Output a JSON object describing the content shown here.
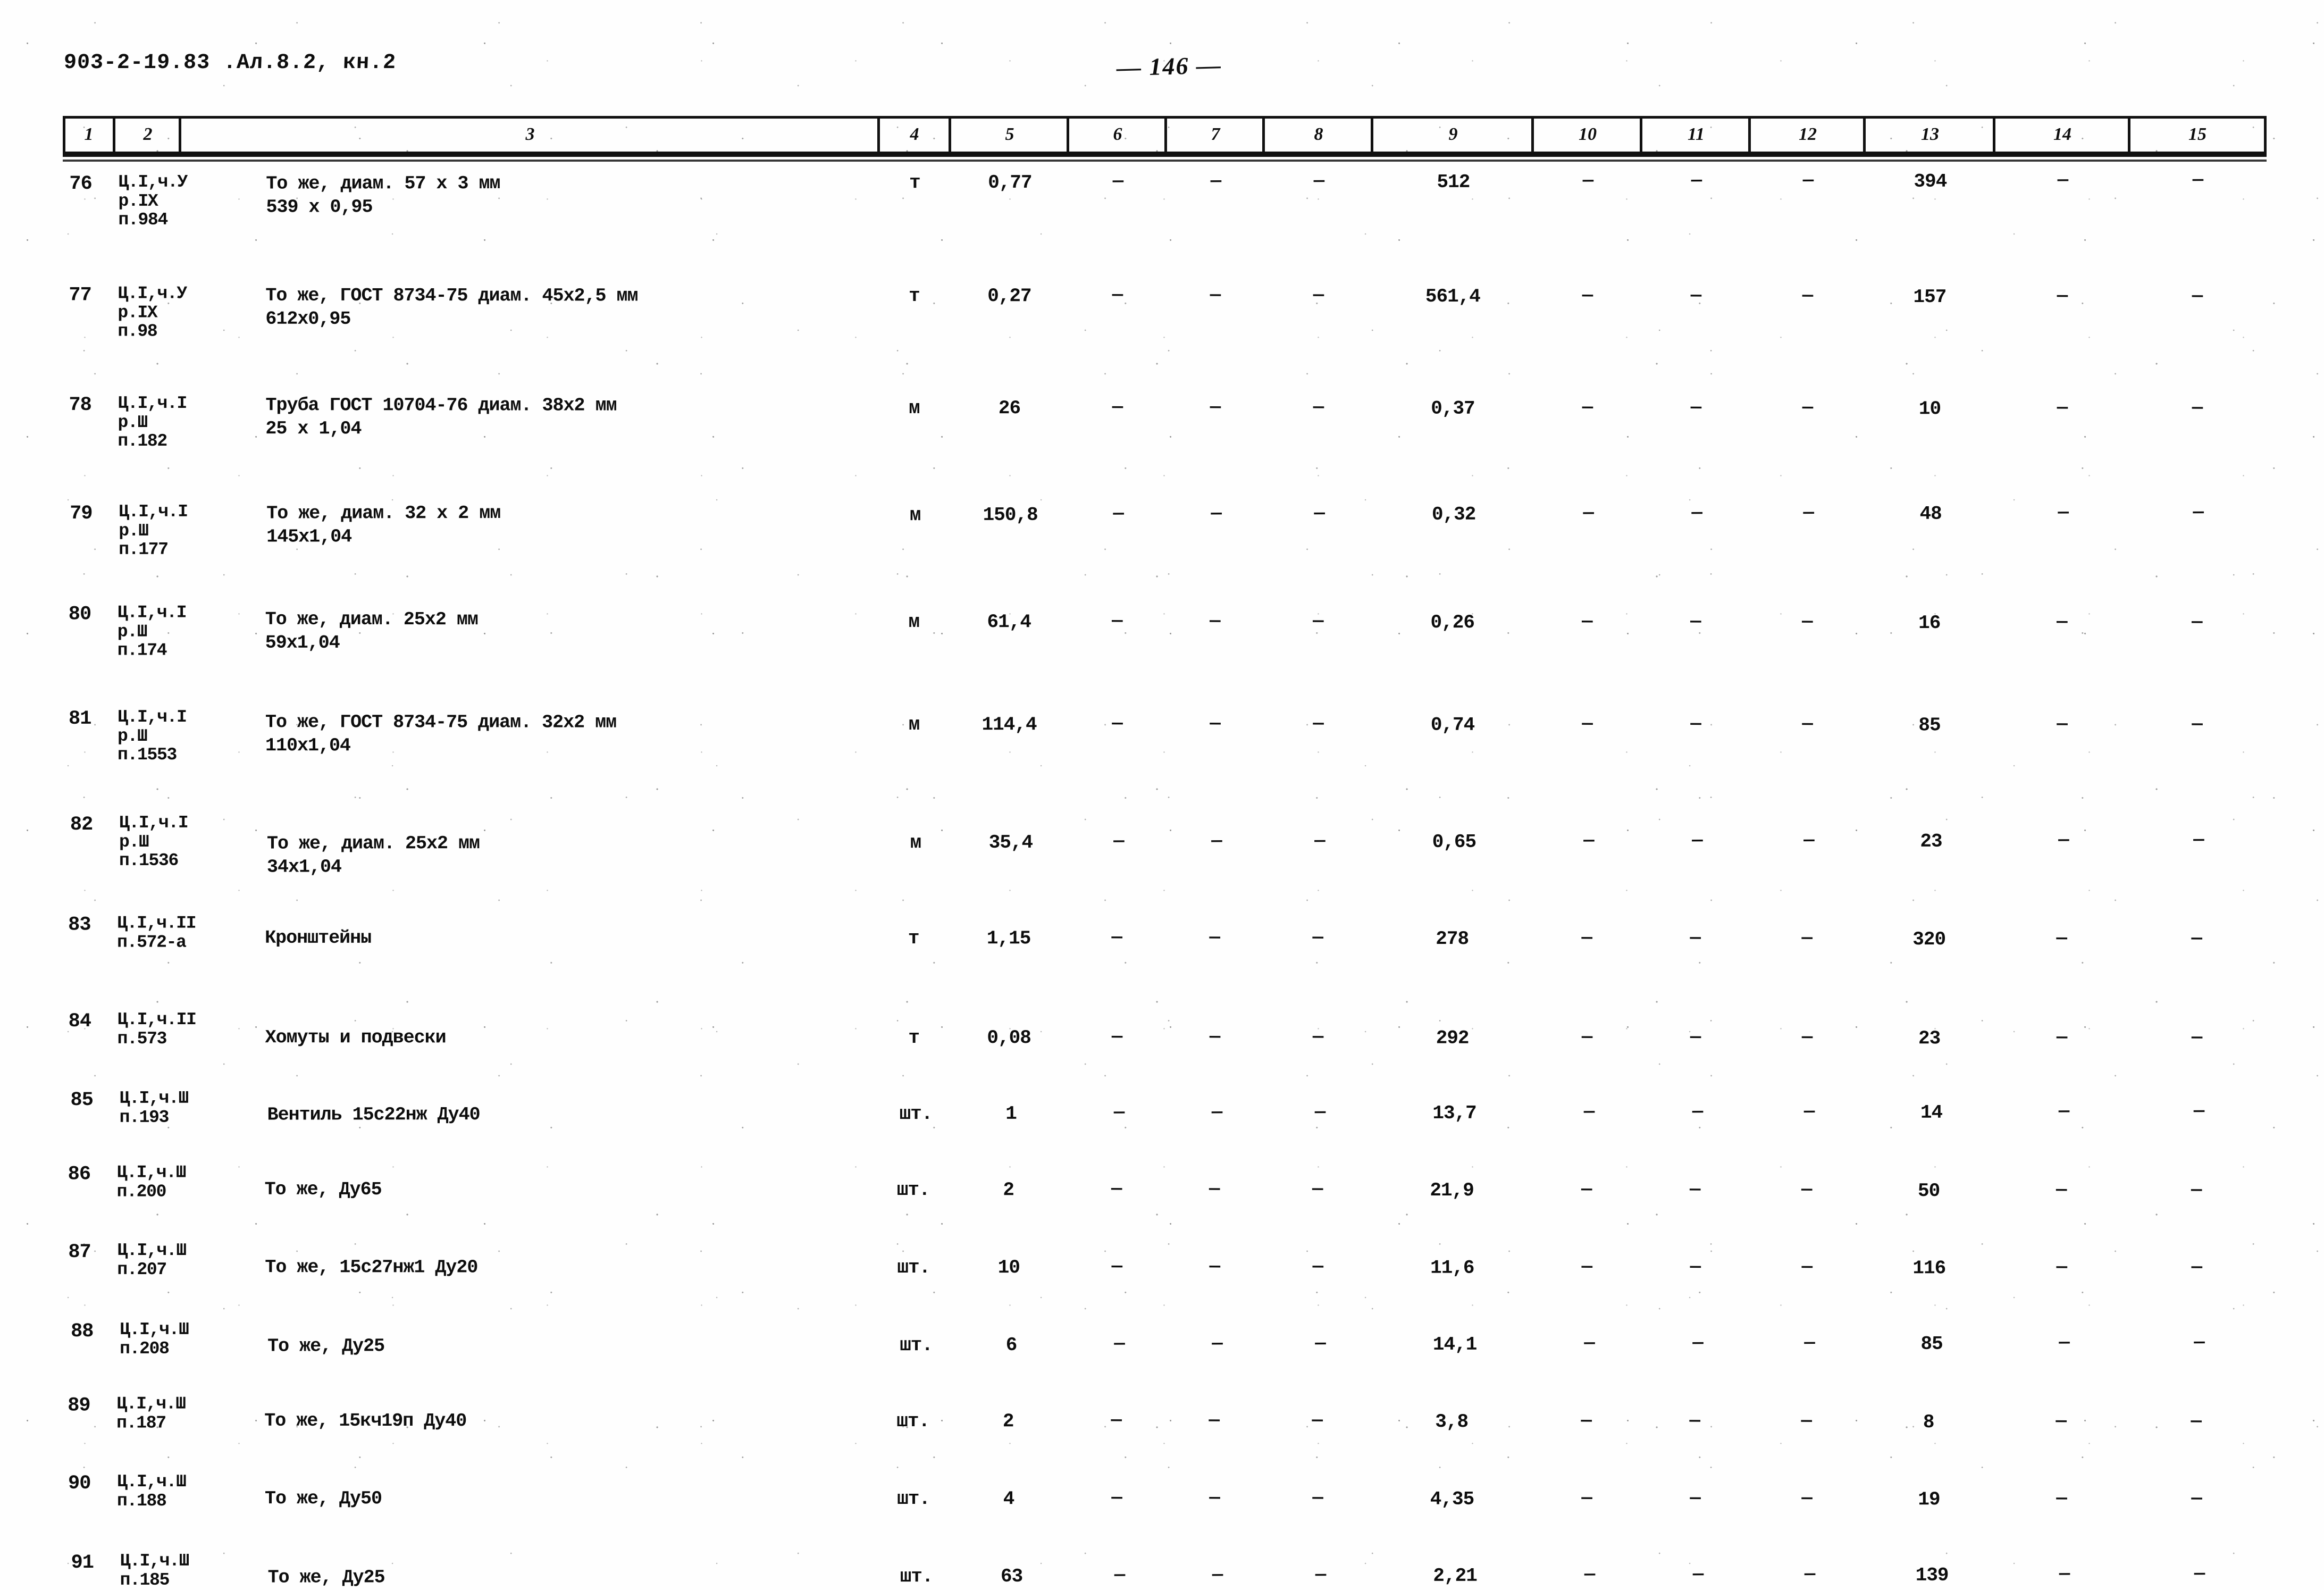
{
  "header": {
    "doc_code": "903-2-19.83 .Ал.8.2, кн.2",
    "page_label": "— 146 —"
  },
  "table": {
    "column_headers": [
      "1",
      "2",
      "3",
      "4",
      "5",
      "6",
      "7",
      "8",
      "9",
      "10",
      "11",
      "12",
      "13",
      "14",
      "15"
    ],
    "dash": "—",
    "rows": [
      {
        "n": "76",
        "ref": [
          "Ц.I,ч.У",
          "р.IX",
          "п.984"
        ],
        "desc": [
          "То же, диам. 57 х 3 мм",
          "539 х 0,95"
        ],
        "c4": "т",
        "c5": "0,77",
        "c6": "—",
        "c7": "—",
        "c8": "—",
        "c9": "512",
        "c10": "—",
        "c11": "—",
        "c12": "—",
        "c13": "394",
        "c14": "—",
        "c15": "—"
      },
      {
        "n": "77",
        "ref": [
          "Ц.I,ч.У",
          "р.IX",
          "п.98"
        ],
        "desc": [
          "То же, ГОСТ 8734-75 диам. 45х2,5 мм",
          "612х0,95"
        ],
        "c4": "т",
        "c5": "0,27",
        "c6": "—",
        "c7": "—",
        "c8": "—",
        "c9": "561,4",
        "c10": "—",
        "c11": "—",
        "c12": "—",
        "c13": "157",
        "c14": "—",
        "c15": "—"
      },
      {
        "n": "78",
        "ref": [
          "Ц.I,ч.I",
          "р.Ш",
          "п.182"
        ],
        "desc": [
          "Труба ГОСТ 10704-76 диам. 38х2 мм",
          "25 х 1,04"
        ],
        "c4": "м",
        "c5": "26",
        "c6": "—",
        "c7": "—",
        "c8": "—",
        "c9": "0,37",
        "c10": "—",
        "c11": "—",
        "c12": "—",
        "c13": "10",
        "c14": "—",
        "c15": "—"
      },
      {
        "n": "79",
        "ref": [
          "Ц.I,ч.I",
          "р.Ш",
          "п.177"
        ],
        "desc": [
          "То же, диам. 32 х 2 мм",
          "145х1,04"
        ],
        "c4": "м",
        "c5": "150,8",
        "c6": "—",
        "c7": "—",
        "c8": "—",
        "c9": "0,32",
        "c10": "—",
        "c11": "—",
        "c12": "—",
        "c13": "48",
        "c14": "—",
        "c15": "—"
      },
      {
        "n": "80",
        "ref": [
          "Ц.I,ч.I",
          "р.Ш",
          "п.174"
        ],
        "desc": [
          "То же, диам. 25х2 мм",
          "59х1,04"
        ],
        "c4": "м",
        "c5": "61,4",
        "c6": "—",
        "c7": "—",
        "c8": "—",
        "c9": "0,26",
        "c10": "—",
        "c11": "—",
        "c12": "—",
        "c13": "16",
        "c14": "—",
        "c15": "—"
      },
      {
        "n": "81",
        "ref": [
          "Ц.I,ч.I",
          "р.Ш",
          "п.1553"
        ],
        "desc": [
          "То же, ГОСТ 8734-75 диам. 32х2 мм",
          "110х1,04"
        ],
        "c4": "м",
        "c5": "114,4",
        "c6": "—",
        "c7": "—",
        "c8": "—",
        "c9": "0,74",
        "c10": "—",
        "c11": "—",
        "c12": "—",
        "c13": "85",
        "c14": "—",
        "c15": "—"
      },
      {
        "n": "82",
        "ref": [
          "Ц.I,ч.I",
          "р.Ш",
          "п.1536"
        ],
        "desc": [
          "То же, диам. 25х2 мм",
          "34х1,04"
        ],
        "c4": "м",
        "c5": "35,4",
        "c6": "—",
        "c7": "—",
        "c8": "—",
        "c9": "0,65",
        "c10": "—",
        "c11": "—",
        "c12": "—",
        "c13": "23",
        "c14": "—",
        "c15": "—"
      },
      {
        "n": "83",
        "ref": [
          "Ц.I,ч.II",
          "п.572-а"
        ],
        "desc": [
          "Кронштейны"
        ],
        "c4": "т",
        "c5": "1,15",
        "c6": "—",
        "c7": "—",
        "c8": "—",
        "c9": "278",
        "c10": "—",
        "c11": "—",
        "c12": "—",
        "c13": "320",
        "c14": "—",
        "c15": "—"
      },
      {
        "n": "84",
        "ref": [
          "Ц.I,ч.II",
          "п.573"
        ],
        "desc": [
          "Хомуты и подвески"
        ],
        "c4": "т",
        "c5": "0,08",
        "c6": "—",
        "c7": "—",
        "c8": "—",
        "c9": "292",
        "c10": "—",
        "c11": "—",
        "c12": "—",
        "c13": "23",
        "c14": "—",
        "c15": "—"
      },
      {
        "n": "85",
        "ref": [
          "Ц.I,ч.Ш",
          "п.193"
        ],
        "desc": [
          "Вентиль 15с22нж Ду40"
        ],
        "c4": "шт.",
        "c5": "1",
        "c6": "—",
        "c7": "—",
        "c8": "—",
        "c9": "13,7",
        "c10": "—",
        "c11": "—",
        "c12": "—",
        "c13": "14",
        "c14": "—",
        "c15": "—"
      },
      {
        "n": "86",
        "ref": [
          "Ц.I,ч.Ш",
          "п.200"
        ],
        "desc": [
          "То же, Ду65"
        ],
        "c4": "шт.",
        "c5": "2",
        "c6": "—",
        "c7": "—",
        "c8": "—",
        "c9": "21,9",
        "c10": "—",
        "c11": "—",
        "c12": "—",
        "c13": "50",
        "c14": "—",
        "c15": "—"
      },
      {
        "n": "87",
        "ref": [
          "Ц.I,ч.Ш",
          "п.207"
        ],
        "desc": [
          "То же, 15с27нж1 Ду20"
        ],
        "c4": "шт.",
        "c5": "10",
        "c6": "—",
        "c7": "—",
        "c8": "—",
        "c9": "11,6",
        "c10": "—",
        "c11": "—",
        "c12": "—",
        "c13": "116",
        "c14": "—",
        "c15": "—"
      },
      {
        "n": "88",
        "ref": [
          "Ц.I,ч.Ш",
          "п.208"
        ],
        "desc": [
          "То же, Ду25"
        ],
        "c4": "шт.",
        "c5": "6",
        "c6": "—",
        "c7": "—",
        "c8": "—",
        "c9": "14,1",
        "c10": "—",
        "c11": "—",
        "c12": "—",
        "c13": "85",
        "c14": "—",
        "c15": "—"
      },
      {
        "n": "89",
        "ref": [
          "Ц.I,ч.Ш",
          "п.187"
        ],
        "desc": [
          "То же, 15кч19п Ду40"
        ],
        "c4": "шт.",
        "c5": "2",
        "c6": "—",
        "c7": "—",
        "c8": "—",
        "c9": "3,8",
        "c10": "—",
        "c11": "—",
        "c12": "—",
        "c13": "8",
        "c14": "—",
        "c15": "—"
      },
      {
        "n": "90",
        "ref": [
          "Ц.I,ч.Ш",
          "п.188"
        ],
        "desc": [
          "То же, Ду50"
        ],
        "c4": "шт.",
        "c5": "4",
        "c6": "—",
        "c7": "—",
        "c8": "—",
        "c9": "4,35",
        "c10": "—",
        "c11": "—",
        "c12": "—",
        "c13": "19",
        "c14": "—",
        "c15": "—"
      },
      {
        "n": "91",
        "ref": [
          "Ц.I,ч.Ш",
          "п.185"
        ],
        "desc": [
          "То же, Ду25"
        ],
        "c4": "шт.",
        "c5": "63",
        "c6": "—",
        "c7": "—",
        "c8": "—",
        "c9": "2,21",
        "c10": "—",
        "c11": "—",
        "c12": "—",
        "c13": "139",
        "c14": "—",
        "c15": "—"
      }
    ]
  }
}
